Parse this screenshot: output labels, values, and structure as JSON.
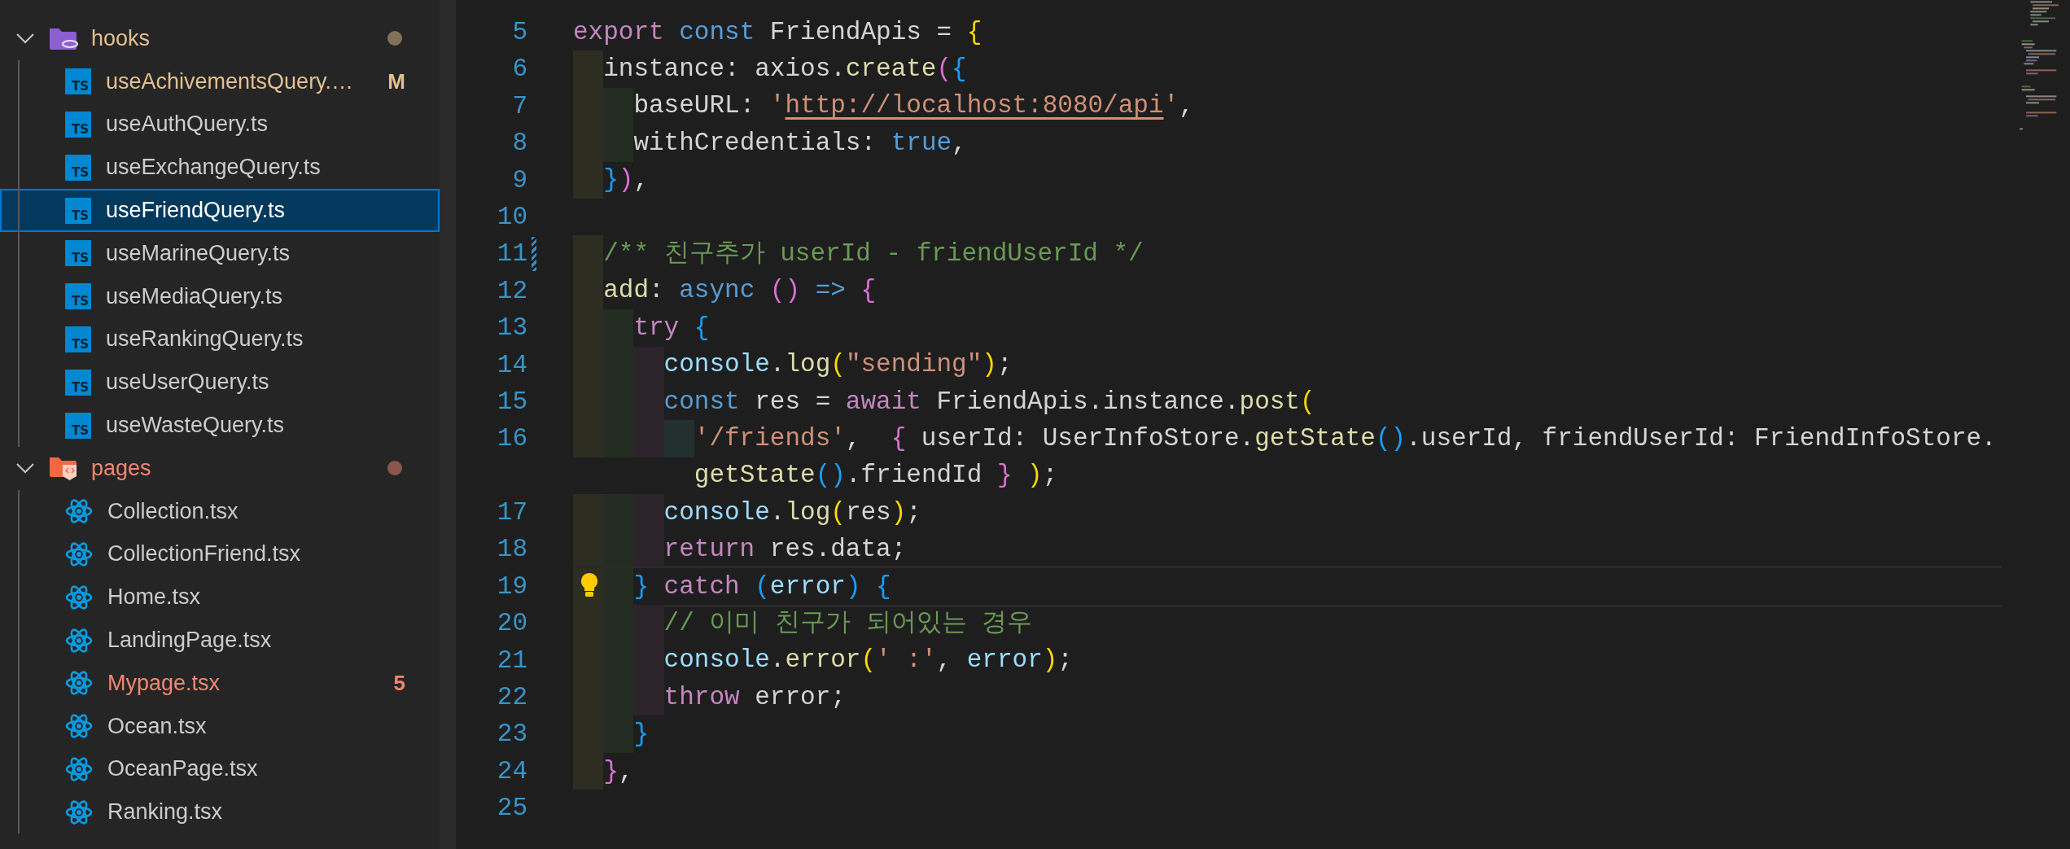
{
  "explorer": {
    "folders": [
      {
        "name": "hooks",
        "kind": "hooks-folder",
        "expanded": true,
        "color": "#e2c08d",
        "children": [
          {
            "name": "useAchivementsQuery.…",
            "kind": "ts",
            "icon_label": "TS",
            "color": "#e2c08d",
            "badge": "M",
            "selected": false
          },
          {
            "name": "useAuthQuery.ts",
            "kind": "ts",
            "icon_label": "TS",
            "selected": false
          },
          {
            "name": "useExchangeQuery.ts",
            "kind": "ts",
            "icon_label": "TS",
            "selected": false
          },
          {
            "name": "useFriendQuery.ts",
            "kind": "ts",
            "icon_label": "TS",
            "selected": true
          },
          {
            "name": "useMarineQuery.ts",
            "kind": "ts",
            "icon_label": "TS",
            "selected": false
          },
          {
            "name": "useMediaQuery.ts",
            "kind": "ts",
            "icon_label": "TS",
            "selected": false
          },
          {
            "name": "useRankingQuery.ts",
            "kind": "ts",
            "icon_label": "TS",
            "selected": false
          },
          {
            "name": "useUserQuery.ts",
            "kind": "ts",
            "icon_label": "TS",
            "selected": false
          },
          {
            "name": "useWasteQuery.ts",
            "kind": "ts",
            "icon_label": "TS",
            "selected": false
          }
        ]
      },
      {
        "name": "pages",
        "kind": "pages-folder",
        "expanded": true,
        "color": "#f48771",
        "children": [
          {
            "name": "Collection.tsx",
            "kind": "react",
            "selected": false
          },
          {
            "name": "CollectionFriend.tsx",
            "kind": "react",
            "selected": false
          },
          {
            "name": "Home.tsx",
            "kind": "react",
            "selected": false
          },
          {
            "name": "LandingPage.tsx",
            "kind": "react",
            "selected": false
          },
          {
            "name": "Mypage.tsx",
            "kind": "react",
            "color": "#f48771",
            "badge": "5",
            "selected": false
          },
          {
            "name": "Ocean.tsx",
            "kind": "react",
            "selected": false
          },
          {
            "name": "OceanPage.tsx",
            "kind": "react",
            "selected": false
          },
          {
            "name": "Ranking.tsx",
            "kind": "react",
            "selected": false
          }
        ]
      }
    ]
  },
  "editor": {
    "lines": [
      {
        "number": "5",
        "modified": false,
        "current": false,
        "tokens": [
          {
            "text": "export",
            "kind": "keyword"
          },
          {
            "text": " const",
            "kind": "storage"
          },
          {
            "text": " FriendApis = ",
            "kind": "plain"
          },
          {
            "text": "{",
            "kind": "bracket1"
          }
        ]
      },
      {
        "number": "6",
        "modified": false,
        "current": false,
        "tokens": [
          {
            "text": "  instance: axios.",
            "kind": "plain"
          },
          {
            "text": "create",
            "kind": "function"
          },
          {
            "text": "(",
            "kind": "bracket2"
          },
          {
            "text": "{",
            "kind": "bracket3"
          }
        ]
      },
      {
        "number": "7",
        "modified": false,
        "current": false,
        "tokens": [
          {
            "text": "    baseURL: ",
            "kind": "plain"
          },
          {
            "text": "'",
            "kind": "string"
          },
          {
            "text": "http://localhost:8080/api",
            "kind": "link"
          },
          {
            "text": "'",
            "kind": "string"
          },
          {
            "text": ",",
            "kind": "plain"
          }
        ]
      },
      {
        "number": "8",
        "modified": false,
        "current": false,
        "tokens": [
          {
            "text": "    withCredentials: ",
            "kind": "plain"
          },
          {
            "text": "true",
            "kind": "storage"
          },
          {
            "text": ",",
            "kind": "plain"
          }
        ]
      },
      {
        "number": "9",
        "modified": false,
        "current": false,
        "tokens": [
          {
            "text": "  }",
            "kind": "bracket3"
          },
          {
            "text": ")",
            "kind": "bracket2"
          },
          {
            "text": ",",
            "kind": "plain"
          }
        ]
      },
      {
        "number": "10",
        "modified": false,
        "current": false
      },
      {
        "number": "11",
        "modified": true,
        "current": false,
        "tokens": [
          {
            "text": "  /** 친구추가 userId - friendUserId */",
            "kind": "comment"
          }
        ]
      },
      {
        "number": "12",
        "modified": false,
        "current": false,
        "tokens": [
          {
            "text": "  add",
            "kind": "function"
          },
          {
            "text": ": ",
            "kind": "plain"
          },
          {
            "text": "async",
            "kind": "storage"
          },
          {
            "text": " ()",
            "kind": "bracket2"
          },
          {
            "text": " =>",
            "kind": "storage"
          },
          {
            "text": " {",
            "kind": "bracket2"
          }
        ]
      },
      {
        "number": "13",
        "modified": false,
        "current": false,
        "tokens": [
          {
            "text": "    try",
            "kind": "keyword"
          },
          {
            "text": " {",
            "kind": "bracket3"
          }
        ]
      },
      {
        "number": "14",
        "modified": false,
        "current": false,
        "tokens": [
          {
            "text": "      console",
            "kind": "variable"
          },
          {
            "text": ".",
            "kind": "plain"
          },
          {
            "text": "log",
            "kind": "function"
          },
          {
            "text": "(",
            "kind": "bracket1"
          },
          {
            "text": "\"sending\"",
            "kind": "string"
          },
          {
            "text": ")",
            "kind": "bracket1"
          },
          {
            "text": ";",
            "kind": "plain"
          }
        ]
      },
      {
        "number": "15",
        "modified": false,
        "current": false,
        "tokens": [
          {
            "text": "      const",
            "kind": "storage"
          },
          {
            "text": " res = ",
            "kind": "plain"
          },
          {
            "text": "await",
            "kind": "keyword"
          },
          {
            "text": " FriendApis.instance.",
            "kind": "plain"
          },
          {
            "text": "post",
            "kind": "function"
          },
          {
            "text": "(",
            "kind": "bracket1"
          }
        ]
      },
      {
        "number": "16",
        "modified": false,
        "current": false,
        "tokens": [
          {
            "text": "        '/friends'",
            "kind": "string"
          },
          {
            "text": ",  ",
            "kind": "plain"
          },
          {
            "text": "{",
            "kind": "bracket2"
          },
          {
            "text": " userId: UserInfoStore.",
            "kind": "plain"
          },
          {
            "text": "getState",
            "kind": "function"
          },
          {
            "text": "()",
            "kind": "bracket3"
          },
          {
            "text": ".userId, friendUserId: FriendInfoStore.",
            "kind": "plain"
          }
        ]
      },
      {
        "modified": false,
        "current": false,
        "tokens": [
          {
            "text": "        getState",
            "kind": "function"
          },
          {
            "text": "()",
            "kind": "bracket3"
          },
          {
            "text": ".friendId ",
            "kind": "plain"
          },
          {
            "text": "}",
            "kind": "bracket2"
          },
          {
            "text": " )",
            "kind": "bracket1"
          },
          {
            "text": ";",
            "kind": "plain"
          }
        ]
      },
      {
        "number": "17",
        "modified": false,
        "current": false,
        "tokens": [
          {
            "text": "      console",
            "kind": "variable"
          },
          {
            "text": ".",
            "kind": "plain"
          },
          {
            "text": "log",
            "kind": "function"
          },
          {
            "text": "(",
            "kind": "bracket1"
          },
          {
            "text": "res",
            "kind": "plain"
          },
          {
            "text": ")",
            "kind": "bracket1"
          },
          {
            "text": ";",
            "kind": "plain"
          }
        ]
      },
      {
        "number": "18",
        "modified": false,
        "current": false,
        "tokens": [
          {
            "text": "      return",
            "kind": "keyword"
          },
          {
            "text": " res.data;",
            "kind": "plain"
          }
        ]
      },
      {
        "number": "19",
        "modified": false,
        "current": true,
        "tokens": [
          {
            "text": "    }",
            "kind": "bracket3"
          },
          {
            "text": " catch",
            "kind": "keyword"
          },
          {
            "text": " (",
            "kind": "bracket3"
          },
          {
            "text": "error",
            "kind": "variable"
          },
          {
            "text": ")",
            "kind": "bracket3"
          },
          {
            "text": " {",
            "kind": "bracket3"
          }
        ]
      },
      {
        "number": "20",
        "modified": false,
        "current": false,
        "tokens": [
          {
            "text": "      // 이미 친구가 되어있는 경우",
            "kind": "comment"
          }
        ]
      },
      {
        "number": "21",
        "modified": false,
        "current": false,
        "tokens": [
          {
            "text": "      console",
            "kind": "variable"
          },
          {
            "text": ".",
            "kind": "plain"
          },
          {
            "text": "error",
            "kind": "function"
          },
          {
            "text": "(",
            "kind": "bracket1"
          },
          {
            "text": "' :'",
            "kind": "string"
          },
          {
            "text": ", ",
            "kind": "plain"
          },
          {
            "text": "error",
            "kind": "variable"
          },
          {
            "text": ")",
            "kind": "bracket1"
          },
          {
            "text": ";",
            "kind": "plain"
          }
        ]
      },
      {
        "number": "22",
        "modified": false,
        "current": false,
        "tokens": [
          {
            "text": "      throw",
            "kind": "keyword"
          },
          {
            "text": " error;",
            "kind": "plain"
          }
        ]
      },
      {
        "number": "23",
        "modified": false,
        "current": false,
        "tokens": [
          {
            "text": "    }",
            "kind": "bracket3"
          }
        ]
      },
      {
        "number": "24",
        "modified": false,
        "current": false,
        "tokens": [
          {
            "text": "  }",
            "kind": "bracket2"
          },
          {
            "text": ",",
            "kind": "plain"
          }
        ]
      },
      {
        "number": "25",
        "modified": false,
        "current": false
      }
    ]
  }
}
